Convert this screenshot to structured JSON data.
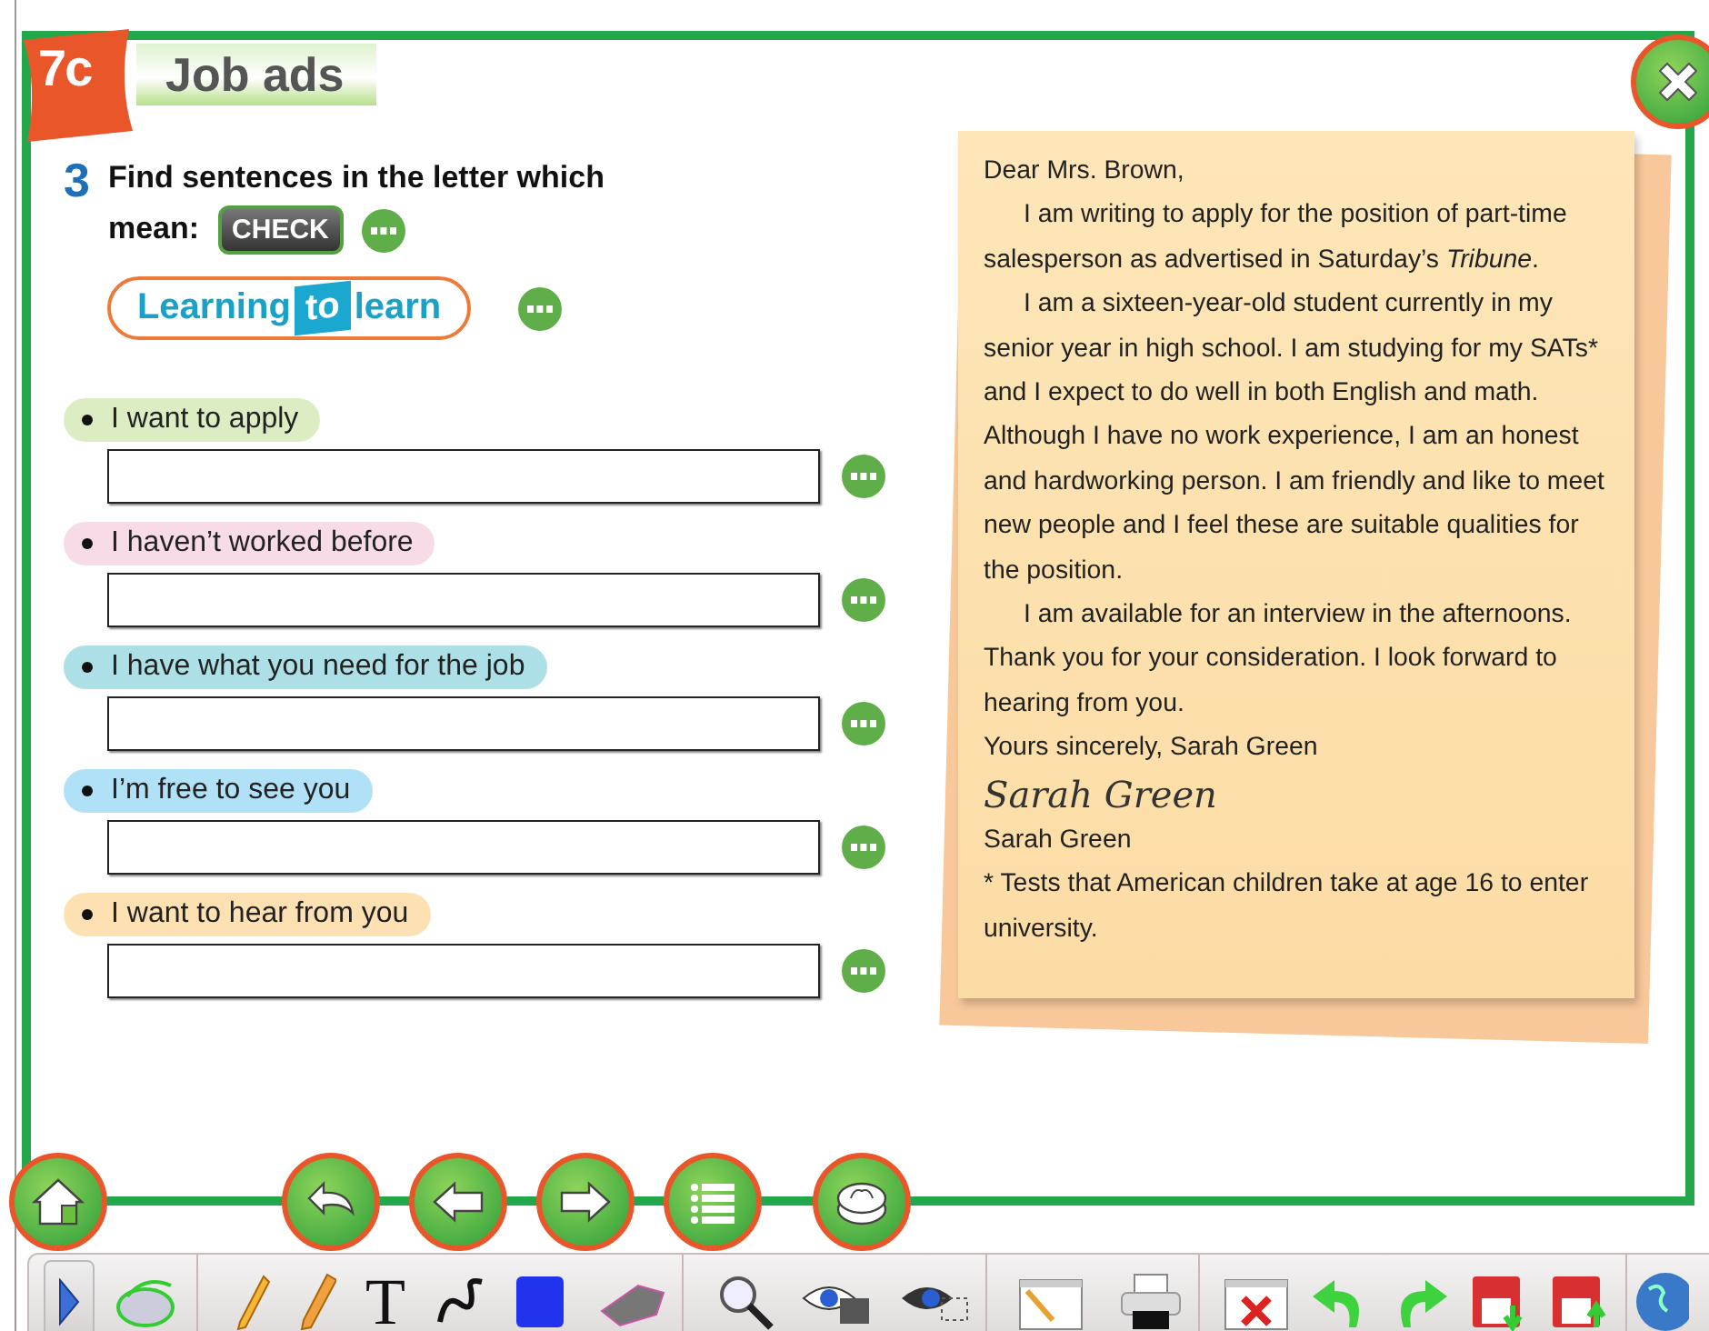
{
  "lesson": {
    "badge": "7c",
    "title": "Job ads"
  },
  "exercise": {
    "number": "3",
    "instruction": [
      "Find sentences in the letter which",
      "mean:"
    ],
    "check_button": "CHECK",
    "skill_logo": [
      "Learning",
      "to",
      "learn"
    ],
    "items": [
      {
        "label": "I want to apply",
        "color": "#dcedc4"
      },
      {
        "label": "I haven’t worked before",
        "color": "#f7dbe7"
      },
      {
        "label": "I have what you need for the job",
        "color": "#ace0e6"
      },
      {
        "label": "I’m free to see you",
        "color": "#b0e1f7"
      },
      {
        "label": "I want to hear from you",
        "color": "#fde1b3"
      }
    ]
  },
  "letter": {
    "paragraphs": [
      {
        "kind": "plain",
        "text": "Dear Mrs. Brown,"
      },
      {
        "kind": "indent",
        "text": "I am writing to apply for the position of part-time salesperson as advertised in Saturday’s *Tribune*."
      },
      {
        "kind": "indent",
        "text": "I am a sixteen-year-old student currently in my senior year in high school. I am studying for my SATs* and I expect to do well in both English and math. Although I have no work experience, I am an honest and hardworking person. I am friendly and like to meet new people and I feel these are suitable qualities for the position."
      },
      {
        "kind": "indent",
        "text": "I am available for an interview in the afternoons. Thank you for your consideration. I look forward to hearing from you."
      },
      {
        "kind": "plain",
        "text": "Yours sincerely, Sarah Green"
      },
      {
        "kind": "signature",
        "text": "Sarah Green"
      },
      {
        "kind": "plain",
        "text": "Sarah Green"
      },
      {
        "kind": "plain",
        "text": "* Tests that American children take at age 16 to enter university."
      }
    ]
  },
  "toolbar": {
    "text_tool": "T"
  }
}
